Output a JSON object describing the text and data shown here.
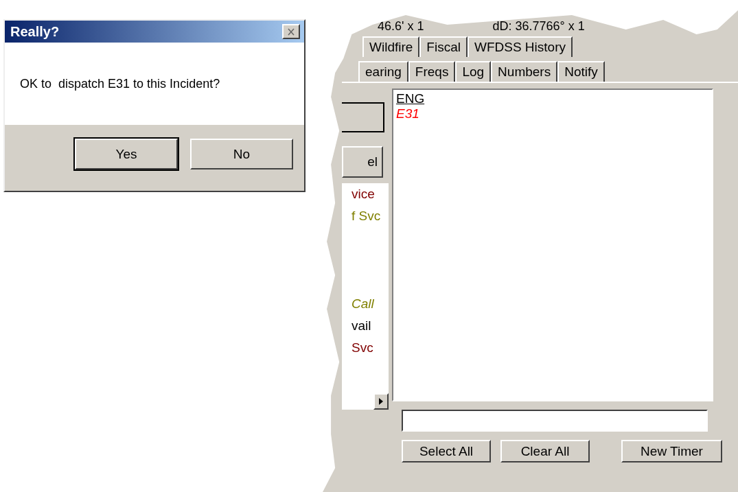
{
  "dialog": {
    "title": "Really?",
    "message": "OK to  dispatch E31 to this Incident?",
    "buttons": [
      {
        "label": "Yes",
        "default": true
      },
      {
        "label": "No",
        "default": false
      }
    ]
  },
  "background_window": {
    "readouts": [
      "46.6' x 1",
      "dD: 36.7766° x 1"
    ],
    "tab_rows": [
      [
        {
          "label": "Wildfire",
          "selected": false
        },
        {
          "label": "Fiscal",
          "selected": false
        },
        {
          "label": "WFDSS History",
          "selected": false
        }
      ],
      [
        {
          "label": "earing",
          "selected": false
        },
        {
          "label": "Freqs",
          "selected": false
        },
        {
          "label": "Log",
          "selected": false
        },
        {
          "label": "Numbers",
          "selected": false
        },
        {
          "label": "Notify",
          "selected": false
        }
      ]
    ],
    "side_button": "el",
    "side_list": [
      {
        "text": "vice",
        "color": "#800000",
        "italic": false
      },
      {
        "text": "f Svc",
        "color": "#808000",
        "italic": false
      },
      {
        "text": "Call",
        "color": "#808000",
        "italic": true
      },
      {
        "text": "vail",
        "color": "#000000",
        "italic": false
      },
      {
        "text": "Svc",
        "color": "#800000",
        "italic": false
      }
    ],
    "list": {
      "header": "ENG",
      "items": [
        {
          "text": "E31",
          "color": "#ff0000",
          "italic": true
        }
      ]
    },
    "buttons": [
      "Select All",
      "Clear All",
      "New Timer"
    ]
  }
}
